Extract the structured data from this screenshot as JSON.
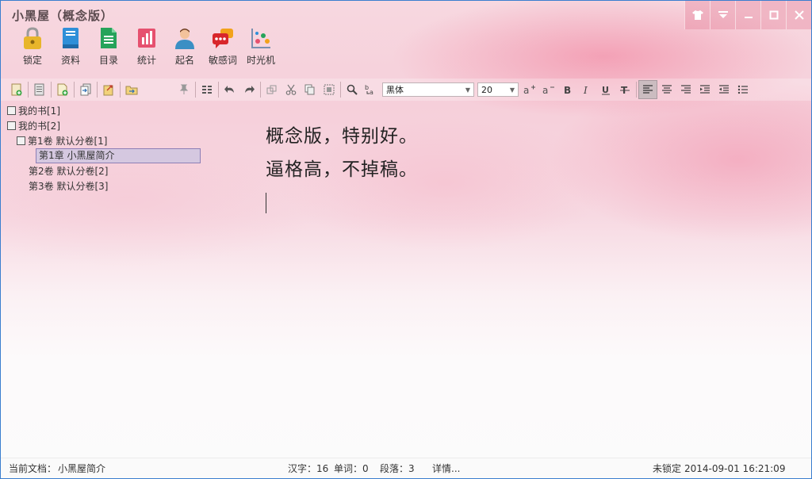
{
  "app": {
    "title": "小黑屋（概念版）"
  },
  "window_controls": {
    "skin": "shirt-icon",
    "menu": "triangle-down-icon",
    "minimize": "minimize-icon",
    "maximize": "maximize-icon",
    "close": "close-icon"
  },
  "main_toolbar": [
    {
      "label": "锁定",
      "icon": "lock-icon",
      "color": "#e8b52b"
    },
    {
      "label": "资料",
      "icon": "book-icon",
      "color": "#2f8fd8"
    },
    {
      "label": "目录",
      "icon": "document-icon",
      "color": "#26a35a"
    },
    {
      "label": "统计",
      "icon": "chart-icon",
      "color": "#e6516f"
    },
    {
      "label": "起名",
      "icon": "person-icon",
      "color": "#3b8fc4"
    },
    {
      "label": "敏感词",
      "icon": "chat-bubble-icon",
      "color": "#d8262b"
    },
    {
      "label": "时光机",
      "icon": "time-machine-icon",
      "color": "#7a8fb0"
    }
  ],
  "edit_toolbar": {
    "font_name": "黑体",
    "font_size": "20"
  },
  "tree": [
    {
      "label": "我的书[1]",
      "level": 0
    },
    {
      "label": "我的书[2]",
      "level": 0
    },
    {
      "label": "第1卷 默认分卷[1]",
      "level": 1
    },
    {
      "label": "第1章 小黑屋简介",
      "level": 2,
      "selected": true
    },
    {
      "label": "第2卷 默认分卷[2]",
      "level": 1
    },
    {
      "label": "第3卷 默认分卷[3]",
      "level": 1
    }
  ],
  "editor": {
    "lines": [
      "概念版，特别好。",
      "逼格高，不掉稿。"
    ]
  },
  "status": {
    "current_doc_label": "当前文档：",
    "current_doc": "小黑屋简介",
    "chars": "汉字：16",
    "words": "单词：0",
    "paragraphs": "段落：3",
    "details": "详情...",
    "lock_state": "未锁定",
    "datetime": "2014-09-01 16:21:09"
  }
}
